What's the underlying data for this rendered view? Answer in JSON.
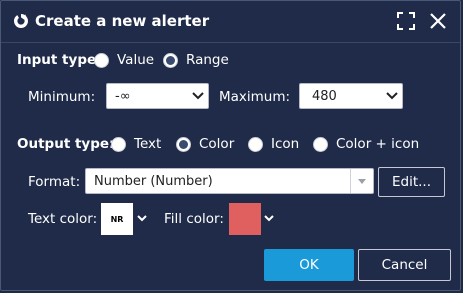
{
  "dialog": {
    "title": "Create a new alerter",
    "icon": "alerter-icon",
    "maximize_icon": "maximize-icon",
    "close_icon": "close-icon"
  },
  "input_type": {
    "label": "Input type:",
    "options": [
      {
        "label": "Value",
        "checked": false
      },
      {
        "label": "Range",
        "checked": true
      }
    ]
  },
  "range": {
    "minimum_label": "Minimum:",
    "minimum_value": "-∞",
    "maximum_label": "Maximum:",
    "maximum_value": "480"
  },
  "output_type": {
    "label": "Output type:",
    "options": [
      {
        "label": "Text",
        "checked": false
      },
      {
        "label": "Color",
        "checked": true
      },
      {
        "label": "Icon",
        "checked": false
      },
      {
        "label": "Color + icon",
        "checked": false
      }
    ]
  },
  "format": {
    "label": "Format:",
    "value": "Number (Number)",
    "edit_label": "Edit..."
  },
  "colors": {
    "text_color_label": "Text color:",
    "text_color_sample": "NR",
    "text_color_value": "#ffffff",
    "fill_color_label": "Fill color:",
    "fill_color_value": "#e06060"
  },
  "buttons": {
    "ok_label": "OK",
    "cancel_label": "Cancel"
  },
  "theme": {
    "background": "#1f2b48",
    "accent": "#1b9ad9"
  }
}
